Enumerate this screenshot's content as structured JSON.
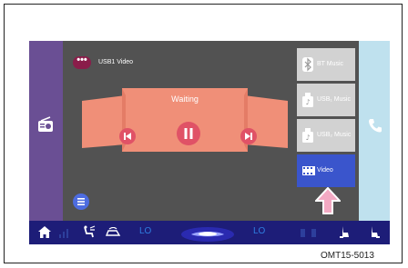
{
  "source": {
    "badge": "•••",
    "label": "USB1 Video"
  },
  "player": {
    "status": "Waiting"
  },
  "menu": [
    {
      "label": "BT Music",
      "icon": "bluetooth-icon",
      "active": false
    },
    {
      "label": "USB₁ Music",
      "icon": "usb-music-icon",
      "active": false
    },
    {
      "label": "USB₂ Music",
      "icon": "usb-music-icon",
      "active": false
    },
    {
      "label": "Video",
      "icon": "film-icon",
      "active": true
    }
  ],
  "bottom_bar": {
    "left_temp": "LO",
    "right_temp": "LO"
  },
  "figure_code": "OMT15-5013",
  "colors": {
    "accent": "#3a55cc",
    "player": "#f08f78",
    "control": "#e05266"
  }
}
